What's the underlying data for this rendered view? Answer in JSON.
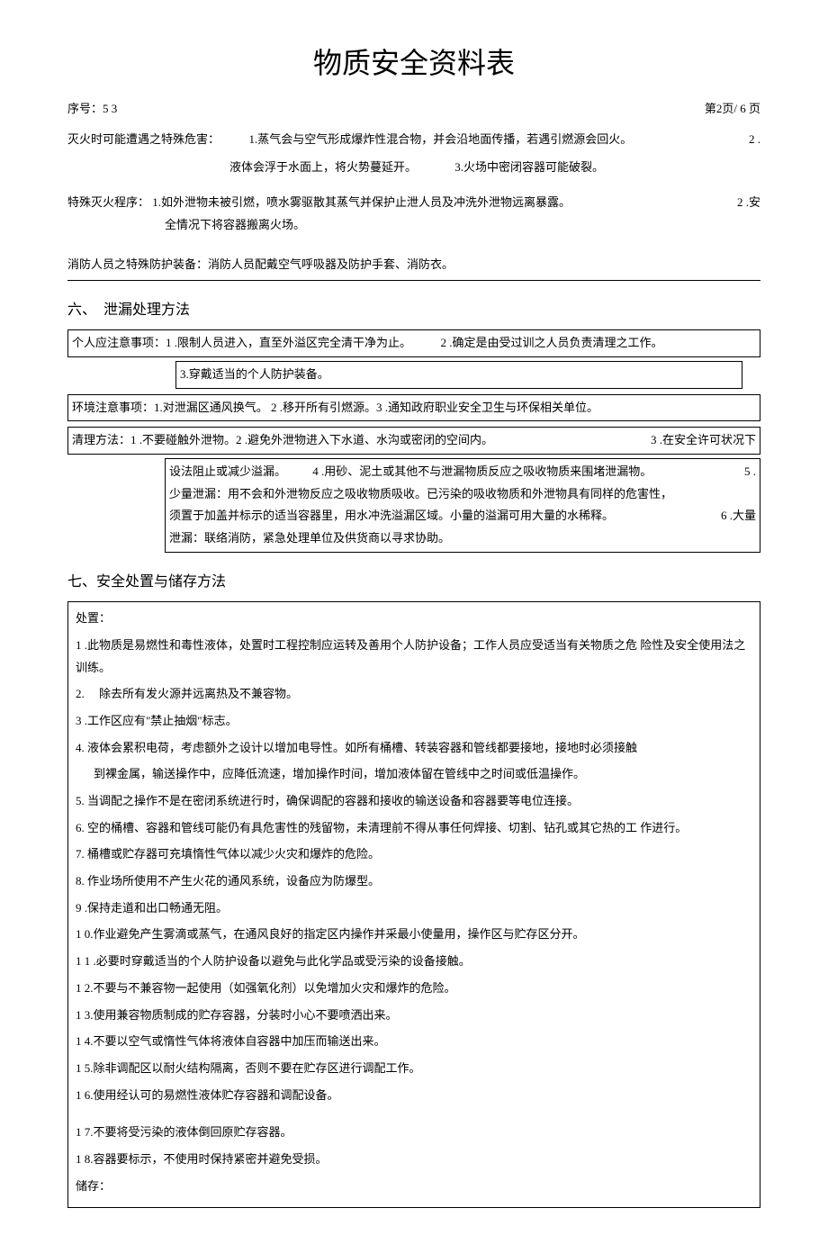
{
  "title": "物质安全资料表",
  "serial_label": "序号：5 3",
  "page_marker": "第2页/ 6 页",
  "fire_hazard_label": "灭火时可能遭遇之特殊危害：",
  "fire_hazard_1": "1.蒸气会与空气形成爆炸性混合物，并会沿地面传播，若遇引燃源会回火。",
  "fire_hazard_2": "2 .",
  "fire_hazard_2b": "液体会浮于水面上，将火势蔓延开。",
  "fire_hazard_3": "3.火场中密闭容器可能破裂。",
  "special_proc_label": "特殊灭火程序：",
  "special_proc_1": "1.如外泄物未被引燃，喷水雾驱散其蒸气并保护止泄人员及冲洗外泄物远离暴露。",
  "special_proc_2a": "2 .安",
  "special_proc_2b": "全情况下将容器搬离火场。",
  "firefighter_equip": "消防人员之特殊防护装备：消防人员配戴空气呼吸器及防护手套、消防衣。",
  "sec6_head": "六、　泄漏处理方法",
  "box6_line1a": "个人应注意事项：1 .限制人员进入，直至外溢区完全清干净为止。",
  "box6_line1b": "2 .确定是由受过训之人员负责清理之工作。",
  "box6_line2": "3.穿戴适当的个人防护装备。",
  "box6_env": "环境注意事项：1.对泄漏区通风换气。 2 .移开所有引燃源。3 .通知政府职业安全卫生与环保相关单位。",
  "box6_clean_a": "清理方法：1 .不要碰触外泄物。2 .避免外泄物进入下水道、水沟或密闭的空间内。",
  "box6_clean_b": "3 .在安全许可状况下",
  "box6_c1a": "设法阻止或减少溢漏。",
  "box6_c1b": "4 .用砂、泥土或其他不与泄漏物质反应之吸收物质来围堵泄漏物。",
  "box6_c1c": "5 .",
  "box6_c2": "少量泄漏：用不会和外泄物反应之吸收物质吸收。已污染的吸收物质和外泄物具有同样的危害性，",
  "box6_c3a": "须置于加盖并标示的适当容器里，用水冲洗溢漏区域。小量的溢漏可用大量的水稀释。",
  "box6_c3b": "6 .大量",
  "box6_c4": "泄漏：联络消防，紧急处理单位及供货商以寻求协助。",
  "sec7_head": "七、安全处置与储存方法",
  "handling_label": "处置：",
  "h1": "1 .此物质是易燃性和毒性液体，处置时工程控制应运转及善用个人防护设备；工作人员应受适当有关物质之危  险性及安全使用法之训练。",
  "h2": "2.　 除去所有发火源并远离热及不兼容物。",
  "h3": "3 .工作区应有\"禁止抽烟\"标志。",
  "h4a": "4.  液体会累积电荷，考虑额外之设计以增加电导性。如所有桶槽、转装容器和管线都要接地，接地时必须接触",
  "h4b": "到裸金属，输送操作中，应降低流速，增加操作时间，增加液体留在管线中之时间或低温操作。",
  "h5": "5.  当调配之操作不是在密闭系统进行时，确保调配的容器和接收的输送设备和容器要等电位连接。",
  "h6": "6.  空的桶槽、容器和管线可能仍有具危害性的残留物，未清理前不得从事任何焊接、切割、钻孔或其它热的工  作进行。",
  "h7": "7.  桶槽或贮存器可充填惰性气体以减少火灾和爆炸的危险。",
  "h8": "8.  作业场所使用不产生火花的通风系统，设备应为防爆型。",
  "h9": "9 .保持走道和出口畅通无阻。",
  "h10": "1 0.作业避免产生雾滴或蒸气，在通风良好的指定区内操作并采最小使量用，操作区与贮存区分开。",
  "h11": "1 1 .必要时穿戴适当的个人防护设备以避免与此化学品或受污染的设备接触。",
  "h12": "1 2.不要与不兼容物一起使用（如强氧化剂）以免增加火灾和爆炸的危险。",
  "h13": "1 3.使用兼容物质制成的贮存容器，分装时小心不要喷洒出来。",
  "h14": "1 4.不要以空气或惰性气体将液体自容器中加压而输送出来。",
  "h15": "1 5.除非调配区以耐火结构隔离，否则不要在贮存区进行调配工作。",
  "h16": "1 6.使用经认可的易燃性液体贮存容器和调配设备。",
  "h17": "1 7.不要将受污染的液体倒回原贮存容器。",
  "h18": "1 8.容器要标示，不使用时保持紧密并避免受损。",
  "storage_label": "储存："
}
